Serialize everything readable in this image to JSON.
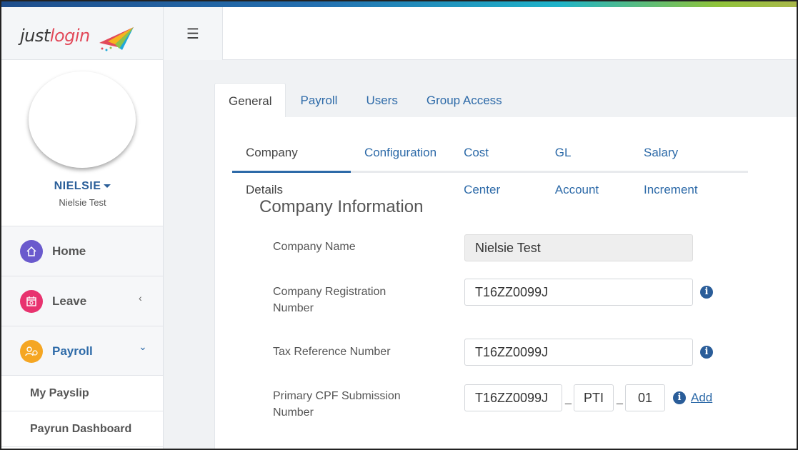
{
  "logo": {
    "part1": "just",
    "part2": "login"
  },
  "profile": {
    "username": "NIELSIE",
    "company": "Nielsie Test"
  },
  "nav": {
    "home": "Home",
    "leave": "Leave",
    "payroll": "Payroll",
    "sub": [
      "My Payslip",
      "Payrun Dashboard"
    ]
  },
  "tabs_main": [
    "General",
    "Payroll",
    "Users",
    "Group Access"
  ],
  "tabs_sub": [
    "Company Details",
    "Configuration",
    "Cost Center",
    "GL Account",
    "Salary Increment"
  ],
  "section_title": "Company Information",
  "fields": {
    "company_name": {
      "label": "Company Name",
      "value": "Nielsie Test"
    },
    "reg_number": {
      "label_line1": "Company Registration",
      "label_line2": "Number",
      "value": "T16ZZ0099J"
    },
    "tax_ref": {
      "label": "Tax Reference Number",
      "value": "T16ZZ0099J"
    },
    "cpf": {
      "label_line1": "Primary CPF Submission",
      "label_line2": "Number",
      "value_main": "T16ZZ0099J",
      "sep": "_",
      "value_type": "PTI",
      "value_seq": "01",
      "add_label": "Add"
    }
  },
  "colors": {
    "accent": "#2d6aa8",
    "home_icon": "#6a5acd",
    "leave_icon": "#e8336f",
    "payroll_icon": "#f5a623"
  },
  "icons": {
    "menu": "hamburger-icon",
    "home": "home-icon",
    "leave": "calendar-icon",
    "payroll": "user-money-icon",
    "info": "info-icon"
  }
}
